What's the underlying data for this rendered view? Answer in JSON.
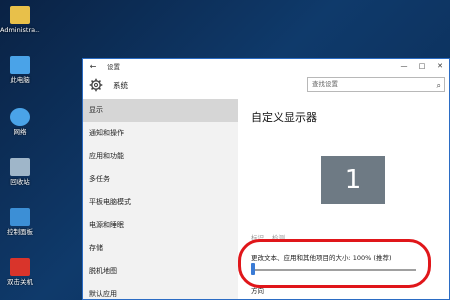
{
  "desktop": {
    "icons": [
      {
        "label": "Administra...",
        "icon": "user-folder-icon",
        "color": "#e8c04a"
      },
      {
        "label": "此电脑",
        "icon": "computer-icon",
        "color": "#4aa3e8"
      },
      {
        "label": "网络",
        "icon": "network-icon",
        "color": "#4aa3e8"
      },
      {
        "label": "回收站",
        "icon": "recycle-bin-icon",
        "color": "#9fb6c9"
      },
      {
        "label": "控制面板",
        "icon": "control-panel-icon",
        "color": "#3c8fd6"
      },
      {
        "label": "双击关机",
        "icon": "power-icon",
        "color": "#d9342b"
      }
    ]
  },
  "window": {
    "title": "设置",
    "back_glyph": "←",
    "controls": {
      "minimize": "—",
      "maximize": "□",
      "close": "✕"
    }
  },
  "header": {
    "section": "系统",
    "search_placeholder": "查找设置",
    "search_glyph": "⌕"
  },
  "sidebar": {
    "items": [
      {
        "label": "显示",
        "active": true
      },
      {
        "label": "通知和操作"
      },
      {
        "label": "应用和功能"
      },
      {
        "label": "多任务"
      },
      {
        "label": "平板电脑模式"
      },
      {
        "label": "电源和睡眠"
      },
      {
        "label": "存储"
      },
      {
        "label": "脱机地图"
      },
      {
        "label": "默认应用"
      }
    ]
  },
  "main": {
    "title": "自定义显示器",
    "monitor_number": "1",
    "identify": "标识",
    "detect": "检测",
    "scale_label": "更改文本、应用和其他项目的大小: 100% (推荐)",
    "scale_value": 0.0,
    "orientation_label": "方向"
  },
  "colors": {
    "accent": "#3a7bd5",
    "highlight": "#e0161a"
  }
}
